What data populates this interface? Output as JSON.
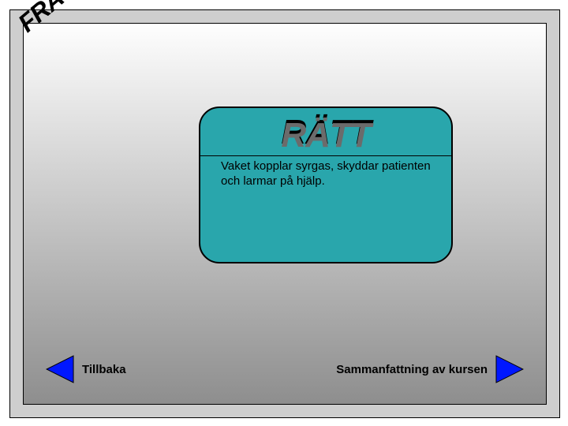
{
  "corner_label": "FRÅGA",
  "card": {
    "title": "RÄTT",
    "body": "Vaket kopplar syrgas, skyddar patienten och larmar på hjälp."
  },
  "nav": {
    "back_label": "Tillbaka",
    "summary_label": "Sammanfattning av kursen"
  }
}
